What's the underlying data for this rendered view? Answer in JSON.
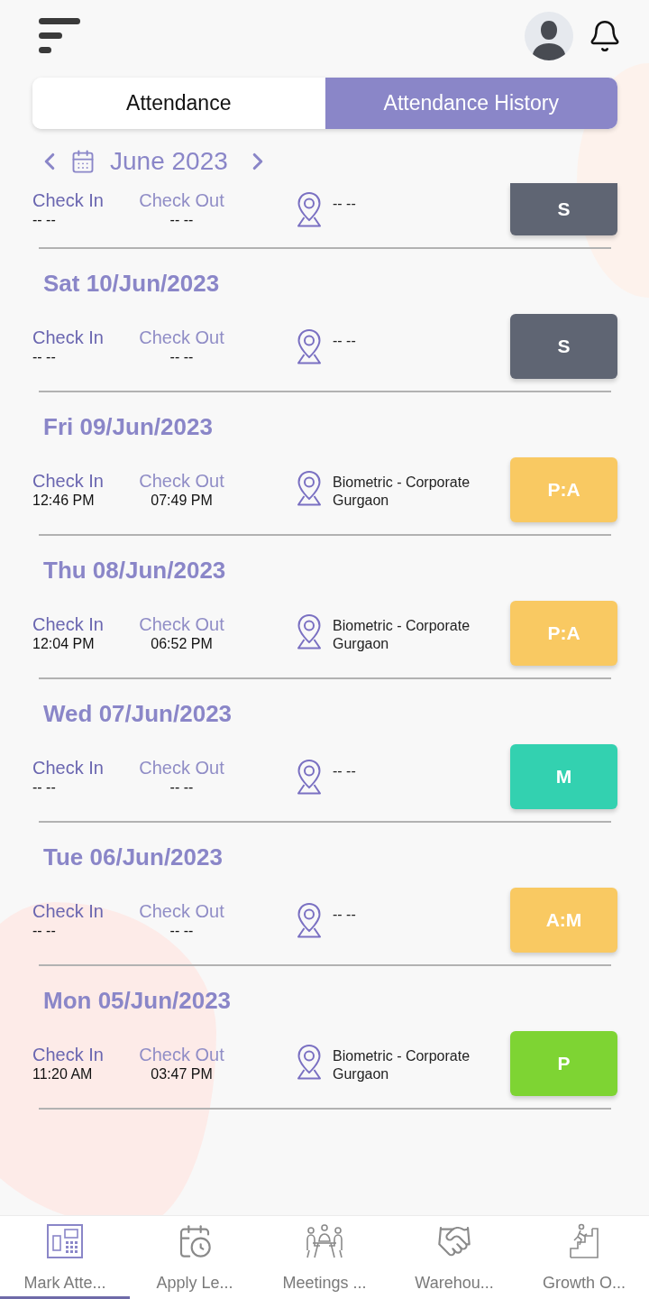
{
  "tabs": [
    {
      "label": "Attendance",
      "selected": false
    },
    {
      "label": "Attendance History",
      "selected": true
    }
  ],
  "month_nav": {
    "label": "June 2023"
  },
  "records": [
    {
      "check_in_label": "Check In",
      "check_in": "-- --",
      "check_out_label": "Check Out",
      "check_out": "-- --",
      "location": "-- --",
      "status": "S",
      "color": "#5f6573"
    },
    {
      "date": "Sat 10/Jun/2023",
      "check_in_label": "Check In",
      "check_in": "-- --",
      "check_out_label": "Check Out",
      "check_out": "-- --",
      "location": "-- --",
      "status": "S",
      "color": "#5f6573"
    },
    {
      "date": "Fri 09/Jun/2023",
      "check_in_label": "Check In",
      "check_in": "12:46 PM",
      "check_out_label": "Check Out",
      "check_out": "07:49 PM",
      "location": "Biometric - Corporate Gurgaon",
      "status": "P:A",
      "color": "#f9c962"
    },
    {
      "date": "Thu 08/Jun/2023",
      "check_in_label": "Check In",
      "check_in": "12:04 PM",
      "check_out_label": "Check Out",
      "check_out": "06:52 PM",
      "location": "Biometric - Corporate Gurgaon",
      "status": "P:A",
      "color": "#f9c962"
    },
    {
      "date": "Wed 07/Jun/2023",
      "check_in_label": "Check In",
      "check_in": "-- --",
      "check_out_label": "Check Out",
      "check_out": "-- --",
      "location": "-- --",
      "status": "M",
      "color": "#33d1b0"
    },
    {
      "date": "Tue 06/Jun/2023",
      "check_in_label": "Check In",
      "check_in": "-- --",
      "check_out_label": "Check Out",
      "check_out": "-- --",
      "location": "-- --",
      "status": "A:M",
      "color": "#f9c962"
    },
    {
      "date": "Mon 05/Jun/2023",
      "check_in_label": "Check In",
      "check_in": "11:20 AM",
      "check_out_label": "Check Out",
      "check_out": "03:47 PM",
      "location": "Biometric - Corporate Gurgaon",
      "status": "P",
      "color": "#7ed433"
    }
  ],
  "bottom_nav": [
    {
      "label": "Mark Atte...",
      "selected": true
    },
    {
      "label": "Apply Le...",
      "selected": false
    },
    {
      "label": "Meetings ...",
      "selected": false
    },
    {
      "label": "Warehou...",
      "selected": false
    },
    {
      "label": "Growth O...",
      "selected": false
    }
  ]
}
